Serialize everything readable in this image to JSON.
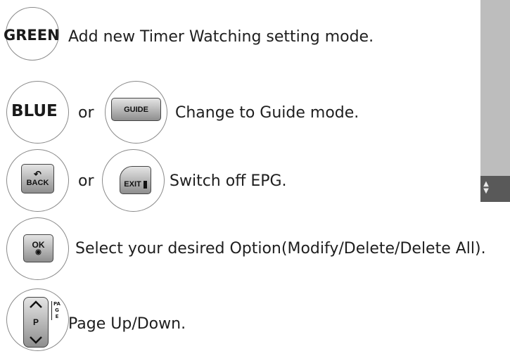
{
  "rows": {
    "green": {
      "key_label": "GREEN",
      "description": "Add new Timer Watching setting mode."
    },
    "blue": {
      "key_label": "BLUE",
      "or_text": "or",
      "guide_key_label": "GUIDE",
      "description": "Change to Guide mode."
    },
    "back": {
      "key_label": "BACK",
      "or_text": "or",
      "exit_key_label": "EXIT",
      "description": "Switch off EPG."
    },
    "ok": {
      "key_label": "OK",
      "description": "Select your desired Option(Modify/Delete/Delete All)."
    },
    "page": {
      "key_label": "P",
      "side_label": "PAGE",
      "description": "Page Up/Down."
    }
  },
  "icons": [
    "back-arrow-icon",
    "exit-door-icon",
    "ok-dot-icon",
    "chevron-up-icon",
    "chevron-down-icon",
    "scroll-arrows-icon"
  ],
  "colors": {
    "text": "#1e1e1e",
    "circle_border": "#8a8a8a",
    "button_fill_top": "#e4e4e4",
    "button_fill_bottom": "#8e8e8e",
    "side_panel": "#bdbdbd",
    "side_panel_dark": "#595959"
  }
}
